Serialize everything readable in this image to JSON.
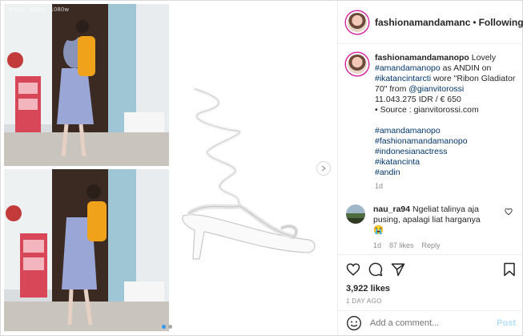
{
  "watermark": "640w · 360w · 1080w",
  "header": {
    "username": "fashionamandamanc",
    "separator": "•",
    "follow_label": "Following"
  },
  "caption": {
    "username": "fashionamandamanopo",
    "text_intro": "Lovely",
    "tag1": "#amandamanopo",
    "text_as": "as ANDIN on",
    "tag2": "#ikatancintarcti",
    "text_wore": "wore \"Ribon Gladiator 70\" from",
    "mention": "@gianvitorossi",
    "price": "11.043.275 IDR / € 650",
    "source": "• Source : gianvitorossi.com",
    "hashtags": [
      "#amandamanopo",
      "#fashionamandamanopo",
      "#indonesianactress",
      "#ikatancinta",
      "#andin"
    ],
    "time": "1d"
  },
  "comment": {
    "username": "nau_ra94",
    "text": "Ngeliat talinya aja pusing, apalagi liat harganya",
    "emoji": "😭",
    "time": "1d",
    "likes": "87 likes",
    "reply_label": "Reply"
  },
  "actions": {
    "likes": "3,922 likes",
    "ago": "1 DAY AGO"
  },
  "add_comment": {
    "placeholder": "Add a comment...",
    "post_label": "Post"
  },
  "carousel": {
    "count": 2,
    "active": 1
  }
}
